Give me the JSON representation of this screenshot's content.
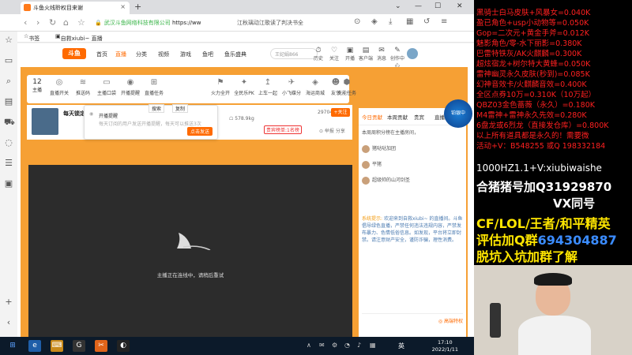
{
  "browser": {
    "tab_title": "斗鱼火线聆权目来谢",
    "tab_close": "×",
    "new_tab": "+",
    "url_host": "武汉斗鱼网络科技有限公司",
    "url_path": "https://ww",
    "search_text": "江秋璃动江歌读了判决书全",
    "bookmarks": [
      "书签",
      "自救xiubi~ 直播"
    ],
    "win_buttons": [
      "⌄",
      "—",
      "☐",
      "✕"
    ]
  },
  "site": {
    "logo": "斗鱼",
    "nav": [
      "首页",
      "直播",
      "分类",
      "视频",
      "游戏",
      "鱼吧",
      "鱼乐盛典"
    ],
    "active_nav": "直播",
    "search_placeholder": "王妃娟866",
    "header_icons": [
      {
        "icon": "⏱",
        "label": "历史"
      },
      {
        "icon": "♡",
        "label": "关注"
      },
      {
        "icon": "▣",
        "label": "开播"
      },
      {
        "icon": "▤",
        "label": "客户端"
      },
      {
        "icon": "✉",
        "label": "消息"
      },
      {
        "icon": "✎",
        "label": "创作中心"
      }
    ]
  },
  "toolbar": {
    "follow_count": "12",
    "follow_label": "主播",
    "items": [
      {
        "icon": "◎",
        "label": "直播开关"
      },
      {
        "icon": "≋",
        "label": "推送码"
      },
      {
        "icon": "▭",
        "label": "主播口袋"
      },
      {
        "icon": "◉",
        "label": "开播提醒"
      },
      {
        "icon": "⊞",
        "label": "直播任务"
      },
      {
        "icon": "⚑",
        "label": "火力全开"
      },
      {
        "icon": "✦",
        "label": "全民乐PK"
      },
      {
        "icon": "↥",
        "label": "上车一起"
      },
      {
        "icon": "✈",
        "label": "小飞碟分"
      },
      {
        "icon": "◈",
        "label": "海运商城"
      },
      {
        "icon": "☻",
        "label": "友邻"
      },
      {
        "icon": "⬢",
        "label": "充能任务"
      },
      {
        "icon": "…",
        "label": "更多"
      }
    ],
    "search_btn": "搜索",
    "copy_btn": "复制"
  },
  "popover": {
    "title": "开播提醒",
    "desc": "每天订阅的用户发送开播提醒，每天可以推送3次",
    "button": "点击发送"
  },
  "streamer": {
    "name": "每天锁定",
    "fans": "578.9kg",
    "rank": "贵宾榜单:1名榜",
    "viewers": "297042",
    "follow": "+关注",
    "report": "⊙ 举报 分享"
  },
  "player": {
    "offline_message": "主播正在连线中，请稍后重试"
  },
  "chat": {
    "tabs": [
      "今日贡献",
      "本周贡献",
      "贵宾",
      "直播间"
    ],
    "rows": [
      "本周周积分榜在主播房间，",
      "猪哒哒加团",
      "平猪",
      "超级帅的山河剑圣"
    ],
    "sys_tag": "系统提示:",
    "sys_msg": "欢迎来到自救xiubi~ 的直播间。斗鱼倡导绿色直播，严禁任何违法违规内容，严禁发布暴力、色情低俗信息。如发现，平台将立即封禁。请注意财产安全，谨防诈骗，理性消费。",
    "input_hint": "◎ 高端特权"
  },
  "badge": {
    "text": "铂银中"
  },
  "overlay": {
    "red_lines": [
      "黑骑士白马皮肤+风暴女=0.040K",
      "盈已角色+usp小动物等=0.050K",
      "Gop=二次元+黄金手斧=0.012K",
      "魅影角色/零-水下丽影=0.380K",
      "巴雷特铁灰/AK火麒麟=0.300K",
      "超炫宿龙+树尔特大黄蜂=0.050K",
      "雷神幽灵永久皮肤(秒到)=0.085K",
      "幻神音效卡/火麒麟音效=0.400K",
      "全区点券10万=0.310K（10万起）",
      "QBZ03金色蔷薇（永久）=0.180K",
      "M4雷神+雷神永久先效=0.280K",
      "6盘龙或6烈龙（直接发仓库）=0.800K",
      "以上所有道具都是永久的！需要微",
      "活动+V：B548255  或Q 198332184"
    ],
    "white1": "1000HZ1.1+V:xiubiwaishe",
    "white2": "合猪猪号加Q31929870",
    "white3": "VX同号",
    "yellow1": "CF/LOL/王者/和平精英",
    "yellow2_a": "评估加Q群",
    "yellow2_b": "694304887",
    "yellow3": "脱坑入坑加群了解"
  },
  "taskbar": {
    "apps": [
      "⊞",
      "e",
      "⌨",
      "G",
      "✂",
      "◐"
    ],
    "time": "17:10",
    "date": "2022/1/11",
    "ime": "英",
    "tray": [
      "∧",
      "✉",
      "⚙",
      "◔",
      "♪",
      "▦"
    ]
  },
  "colors": {
    "accent": "#ff6a00",
    "frame": "#f6a034",
    "overlay_red": "#ff2020",
    "overlay_yellow": "#ffe600"
  }
}
